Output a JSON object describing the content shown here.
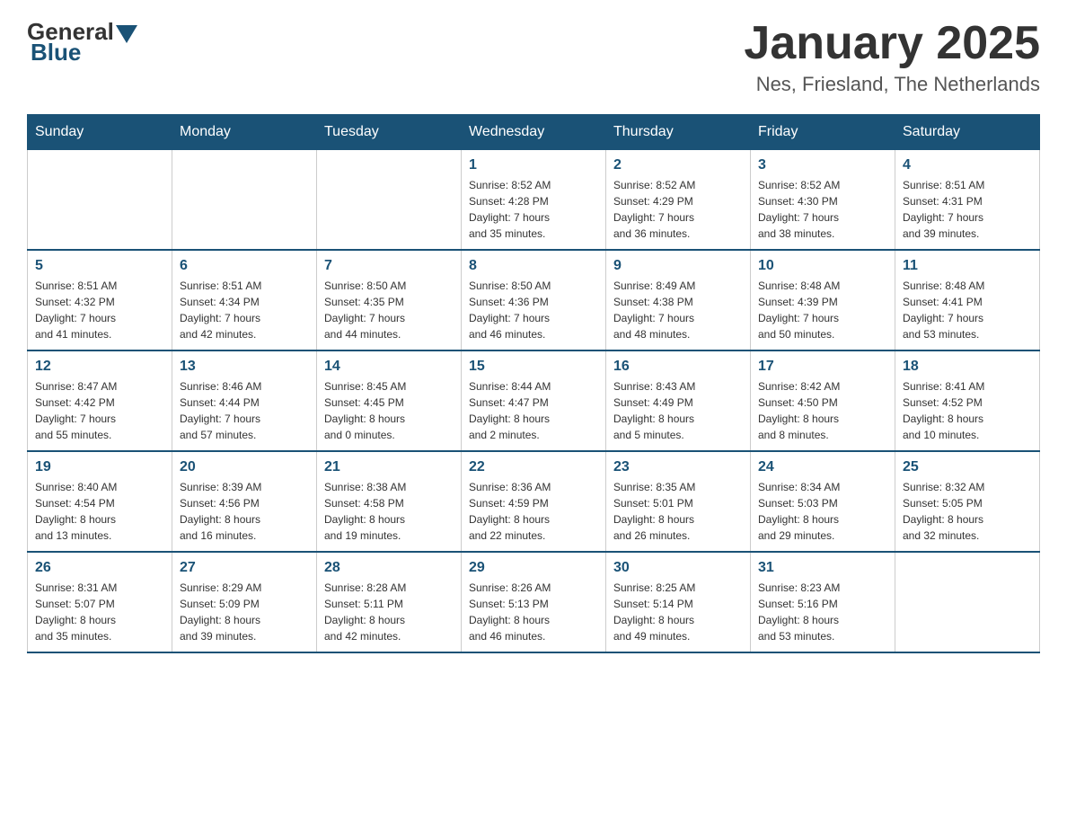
{
  "header": {
    "logo": {
      "part1": "General",
      "part2": "Blue"
    },
    "title": "January 2025",
    "subtitle": "Nes, Friesland, The Netherlands"
  },
  "weekdays": [
    "Sunday",
    "Monday",
    "Tuesday",
    "Wednesday",
    "Thursday",
    "Friday",
    "Saturday"
  ],
  "weeks": [
    [
      {
        "day": "",
        "info": ""
      },
      {
        "day": "",
        "info": ""
      },
      {
        "day": "",
        "info": ""
      },
      {
        "day": "1",
        "info": "Sunrise: 8:52 AM\nSunset: 4:28 PM\nDaylight: 7 hours\nand 35 minutes."
      },
      {
        "day": "2",
        "info": "Sunrise: 8:52 AM\nSunset: 4:29 PM\nDaylight: 7 hours\nand 36 minutes."
      },
      {
        "day": "3",
        "info": "Sunrise: 8:52 AM\nSunset: 4:30 PM\nDaylight: 7 hours\nand 38 minutes."
      },
      {
        "day": "4",
        "info": "Sunrise: 8:51 AM\nSunset: 4:31 PM\nDaylight: 7 hours\nand 39 minutes."
      }
    ],
    [
      {
        "day": "5",
        "info": "Sunrise: 8:51 AM\nSunset: 4:32 PM\nDaylight: 7 hours\nand 41 minutes."
      },
      {
        "day": "6",
        "info": "Sunrise: 8:51 AM\nSunset: 4:34 PM\nDaylight: 7 hours\nand 42 minutes."
      },
      {
        "day": "7",
        "info": "Sunrise: 8:50 AM\nSunset: 4:35 PM\nDaylight: 7 hours\nand 44 minutes."
      },
      {
        "day": "8",
        "info": "Sunrise: 8:50 AM\nSunset: 4:36 PM\nDaylight: 7 hours\nand 46 minutes."
      },
      {
        "day": "9",
        "info": "Sunrise: 8:49 AM\nSunset: 4:38 PM\nDaylight: 7 hours\nand 48 minutes."
      },
      {
        "day": "10",
        "info": "Sunrise: 8:48 AM\nSunset: 4:39 PM\nDaylight: 7 hours\nand 50 minutes."
      },
      {
        "day": "11",
        "info": "Sunrise: 8:48 AM\nSunset: 4:41 PM\nDaylight: 7 hours\nand 53 minutes."
      }
    ],
    [
      {
        "day": "12",
        "info": "Sunrise: 8:47 AM\nSunset: 4:42 PM\nDaylight: 7 hours\nand 55 minutes."
      },
      {
        "day": "13",
        "info": "Sunrise: 8:46 AM\nSunset: 4:44 PM\nDaylight: 7 hours\nand 57 minutes."
      },
      {
        "day": "14",
        "info": "Sunrise: 8:45 AM\nSunset: 4:45 PM\nDaylight: 8 hours\nand 0 minutes."
      },
      {
        "day": "15",
        "info": "Sunrise: 8:44 AM\nSunset: 4:47 PM\nDaylight: 8 hours\nand 2 minutes."
      },
      {
        "day": "16",
        "info": "Sunrise: 8:43 AM\nSunset: 4:49 PM\nDaylight: 8 hours\nand 5 minutes."
      },
      {
        "day": "17",
        "info": "Sunrise: 8:42 AM\nSunset: 4:50 PM\nDaylight: 8 hours\nand 8 minutes."
      },
      {
        "day": "18",
        "info": "Sunrise: 8:41 AM\nSunset: 4:52 PM\nDaylight: 8 hours\nand 10 minutes."
      }
    ],
    [
      {
        "day": "19",
        "info": "Sunrise: 8:40 AM\nSunset: 4:54 PM\nDaylight: 8 hours\nand 13 minutes."
      },
      {
        "day": "20",
        "info": "Sunrise: 8:39 AM\nSunset: 4:56 PM\nDaylight: 8 hours\nand 16 minutes."
      },
      {
        "day": "21",
        "info": "Sunrise: 8:38 AM\nSunset: 4:58 PM\nDaylight: 8 hours\nand 19 minutes."
      },
      {
        "day": "22",
        "info": "Sunrise: 8:36 AM\nSunset: 4:59 PM\nDaylight: 8 hours\nand 22 minutes."
      },
      {
        "day": "23",
        "info": "Sunrise: 8:35 AM\nSunset: 5:01 PM\nDaylight: 8 hours\nand 26 minutes."
      },
      {
        "day": "24",
        "info": "Sunrise: 8:34 AM\nSunset: 5:03 PM\nDaylight: 8 hours\nand 29 minutes."
      },
      {
        "day": "25",
        "info": "Sunrise: 8:32 AM\nSunset: 5:05 PM\nDaylight: 8 hours\nand 32 minutes."
      }
    ],
    [
      {
        "day": "26",
        "info": "Sunrise: 8:31 AM\nSunset: 5:07 PM\nDaylight: 8 hours\nand 35 minutes."
      },
      {
        "day": "27",
        "info": "Sunrise: 8:29 AM\nSunset: 5:09 PM\nDaylight: 8 hours\nand 39 minutes."
      },
      {
        "day": "28",
        "info": "Sunrise: 8:28 AM\nSunset: 5:11 PM\nDaylight: 8 hours\nand 42 minutes."
      },
      {
        "day": "29",
        "info": "Sunrise: 8:26 AM\nSunset: 5:13 PM\nDaylight: 8 hours\nand 46 minutes."
      },
      {
        "day": "30",
        "info": "Sunrise: 8:25 AM\nSunset: 5:14 PM\nDaylight: 8 hours\nand 49 minutes."
      },
      {
        "day": "31",
        "info": "Sunrise: 8:23 AM\nSunset: 5:16 PM\nDaylight: 8 hours\nand 53 minutes."
      },
      {
        "day": "",
        "info": ""
      }
    ]
  ]
}
